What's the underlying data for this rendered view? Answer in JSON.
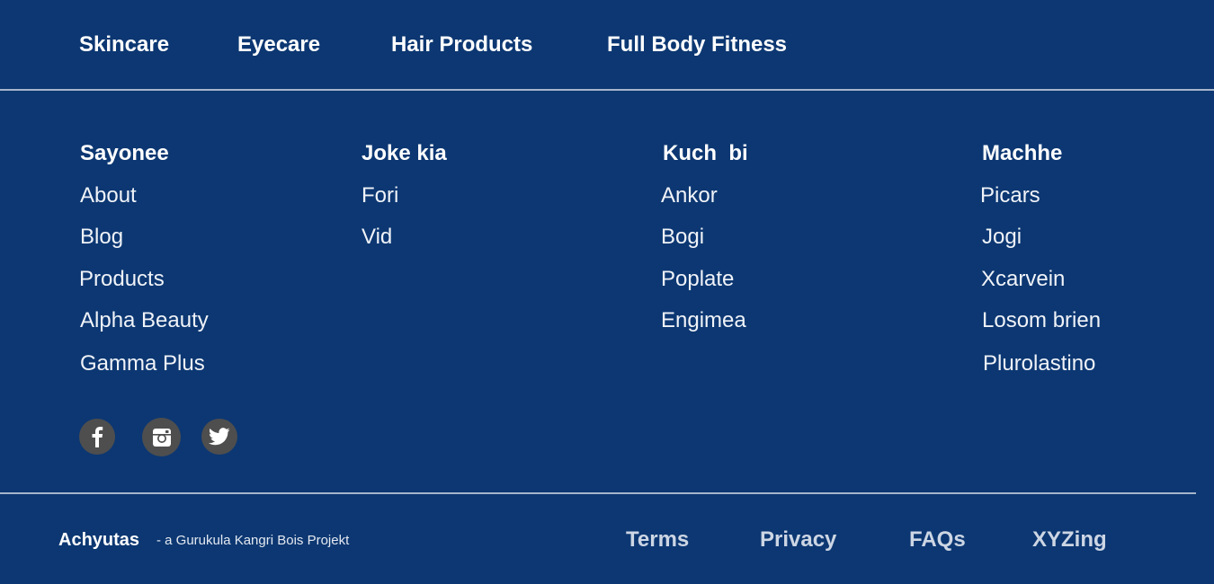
{
  "top_nav": [
    "Skincare",
    "Eyecare",
    "Hair Products",
    "Full Body Fitness"
  ],
  "columns": [
    {
      "heading": "Sayonee",
      "links": [
        "About",
        "Blog",
        "Products",
        "Alpha Beauty",
        "Gamma Plus"
      ]
    },
    {
      "heading": "Joke kia",
      "links": [
        "Fori",
        "Vid"
      ]
    },
    {
      "heading": "Kuch  bi",
      "links": [
        "Ankor",
        "Bogi",
        "Poplate",
        "Engimea"
      ]
    },
    {
      "heading": "Machhe",
      "links": [
        "Picars",
        "Jogi",
        "Xcarvein",
        "Losom brien",
        "Plurolastino"
      ]
    }
  ],
  "social": [
    {
      "icon": "facebook-icon"
    },
    {
      "icon": "instagram-icon"
    },
    {
      "icon": "twitter-icon"
    }
  ],
  "footer": {
    "brand": "Achyutas",
    "tagline": "- a Gurukula Kangri Bois Projekt",
    "links": [
      "Terms",
      "Privacy",
      "FAQs",
      "XYZing"
    ]
  },
  "colors": {
    "background": "#0c3772",
    "rule": "#a7b5cc",
    "social_bg": "#4e4e4e",
    "text": "#ffffff"
  }
}
